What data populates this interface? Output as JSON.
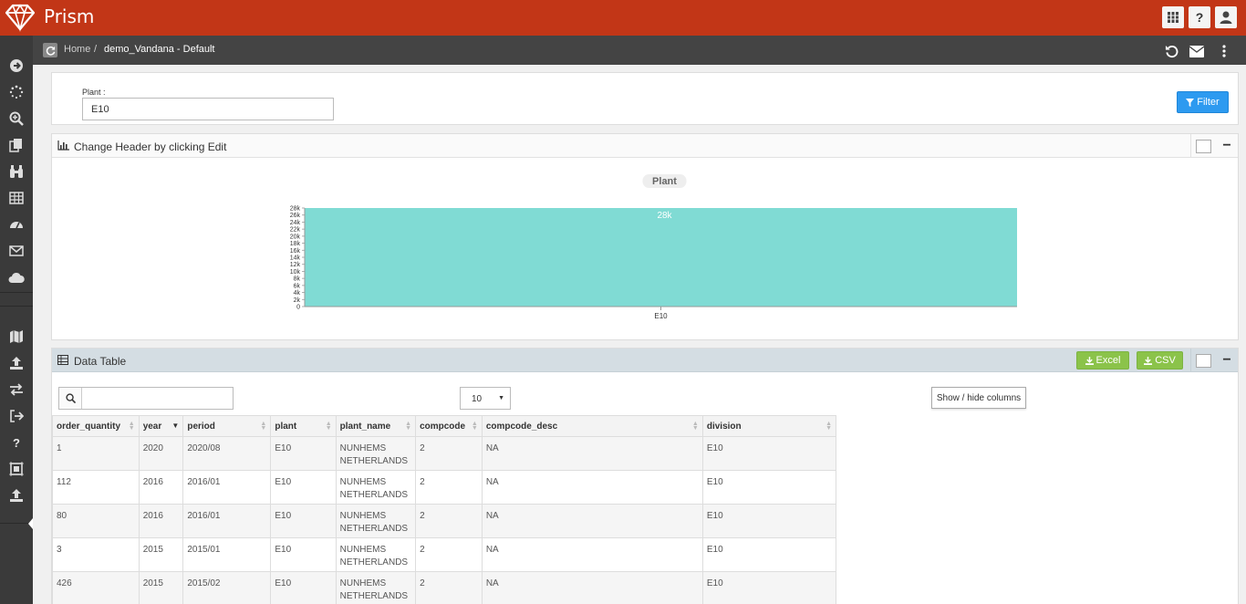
{
  "app": {
    "brand": "Prism"
  },
  "topbar": {
    "grid_btn": "apps-grid",
    "help_btn": "?",
    "user_btn": "user"
  },
  "breadcrumb": {
    "home": "Home",
    "separator": "/",
    "current": "demo_Vandana - Default"
  },
  "filter": {
    "label": "Plant :",
    "value": "E10",
    "button": "Filter"
  },
  "chart_panel": {
    "title": "Change Header by clicking Edit"
  },
  "chart_data": {
    "type": "bar",
    "title": "Plant",
    "categories": [
      "E10"
    ],
    "values": [
      28000
    ],
    "data_labels": [
      "28k"
    ],
    "ylim": [
      0,
      28000
    ],
    "yticks": [
      "0",
      "2k",
      "4k",
      "6k",
      "8k",
      "10k",
      "12k",
      "14k",
      "16k",
      "18k",
      "20k",
      "22k",
      "24k",
      "26k",
      "28k"
    ],
    "bar_color": "#80dbd4",
    "grid": false,
    "legend": "none"
  },
  "table_panel": {
    "title": "Data Table",
    "excel": "Excel",
    "csv": "CSV",
    "page_size": "10",
    "show_hide": "Show / hide columns",
    "search_placeholder": "",
    "columns": [
      "order_quantity",
      "year",
      "period",
      "plant",
      "plant_name",
      "compcode",
      "compcode_desc",
      "division"
    ],
    "rows": [
      [
        "1",
        "2020",
        "2020/08",
        "E10",
        "NUNHEMS NETHERLANDS",
        "2",
        "NA",
        "E10"
      ],
      [
        "112",
        "2016",
        "2016/01",
        "E10",
        "NUNHEMS NETHERLANDS",
        "2",
        "NA",
        "E10"
      ],
      [
        "80",
        "2016",
        "2016/01",
        "E10",
        "NUNHEMS NETHERLANDS",
        "2",
        "NA",
        "E10"
      ],
      [
        "3",
        "2015",
        "2015/01",
        "E10",
        "NUNHEMS NETHERLANDS",
        "2",
        "NA",
        "E10"
      ],
      [
        "426",
        "2015",
        "2015/02",
        "E10",
        "NUNHEMS NETHERLANDS",
        "2",
        "NA",
        "E10"
      ]
    ]
  },
  "colors": {
    "topbar": "#c23617",
    "sidebar": "#3a3a3a",
    "filter_button": "#2d9af0",
    "export_button": "#8bc34a"
  }
}
